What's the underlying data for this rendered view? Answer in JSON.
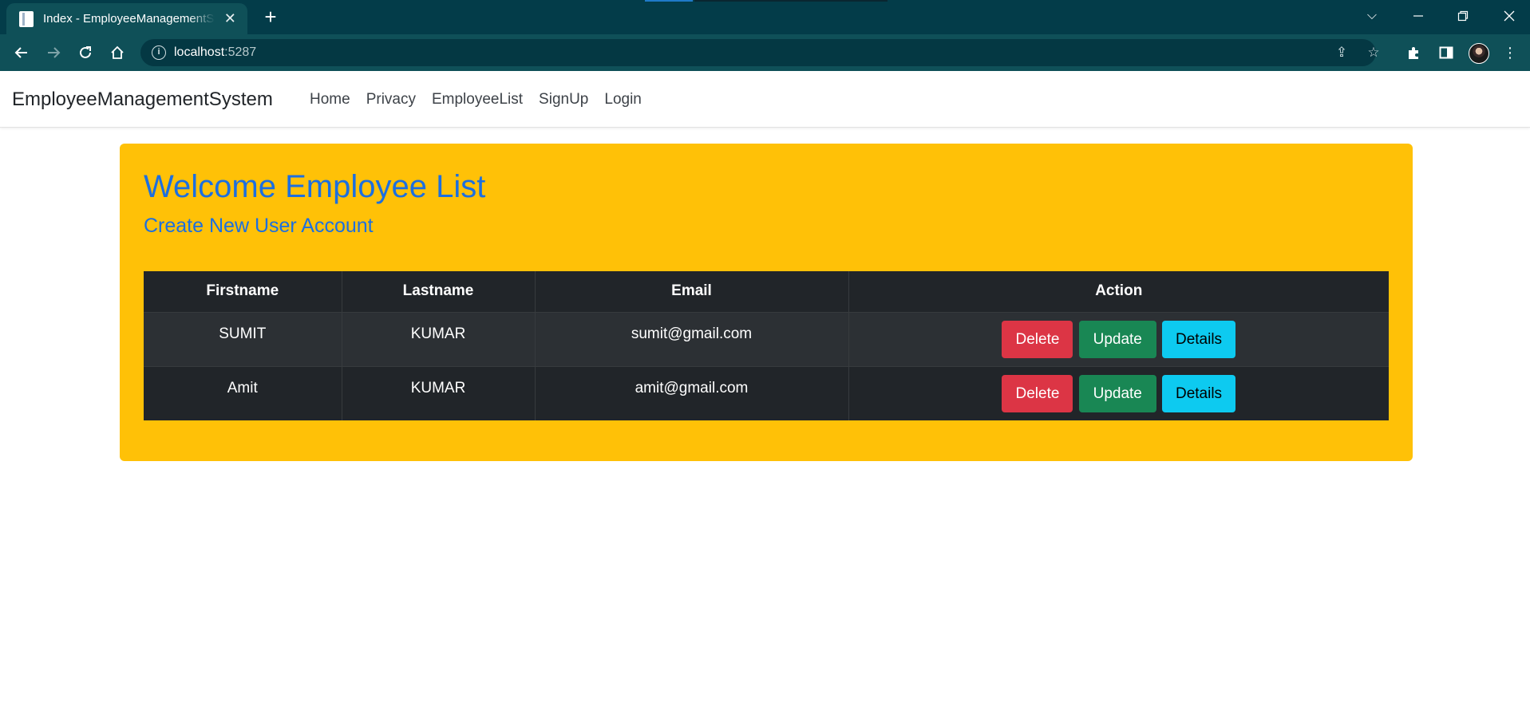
{
  "browser": {
    "tab_title": "Index - EmployeeManagementSystem",
    "url_host": "localhost",
    "url_port": ":5287"
  },
  "site": {
    "brand": "EmployeeManagementSystem",
    "nav": [
      "Home",
      "Privacy",
      "EmployeeList",
      "SignUp",
      "Login"
    ]
  },
  "panel": {
    "title": "Welcome Employee List",
    "create_link": "Create New User Account",
    "bg_color": "#ffc107",
    "heading_color": "#1c6fe0"
  },
  "table": {
    "columns": [
      "Firstname",
      "Lastname",
      "Email",
      "Action"
    ],
    "rows": [
      {
        "firstname": "SUMIT",
        "lastname": "KUMAR",
        "email": "sumit@gmail.com"
      },
      {
        "firstname": "Amit",
        "lastname": "KUMAR",
        "email": "amit@gmail.com"
      }
    ],
    "actions": {
      "delete": "Delete",
      "update": "Update",
      "details": "Details"
    }
  },
  "icons": {
    "back": "arrow-left-icon",
    "forward": "arrow-right-icon",
    "reload": "reload-icon",
    "home": "home-icon",
    "share": "share-icon",
    "bookmark": "star-icon",
    "extensions": "puzzle-icon",
    "side_panel": "side-panel-icon",
    "menu": "kebab-menu-icon"
  }
}
